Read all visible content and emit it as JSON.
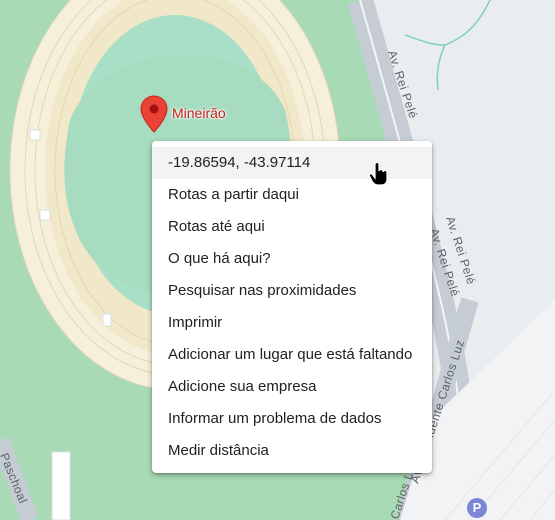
{
  "map": {
    "colors": {
      "field": "#aadfc7",
      "green": "#a8dab5",
      "road": "#c6ccd4",
      "land": "#e9edf0",
      "stands": "#f6efd9",
      "marker": "#ea4335"
    },
    "place": {
      "name": "Mineirão",
      "icon": "map-pin-icon"
    },
    "streets": [
      {
        "id": "rei-pele-top",
        "name": "Av. Rei Pelé"
      },
      {
        "id": "rei-pele-mid",
        "name": "Av. Rei Pelé"
      },
      {
        "id": "rei-pele-low",
        "name": "Av. Rei Pelé"
      },
      {
        "id": "carlos-luz",
        "name": "Av. Presidente Carlos Luz"
      },
      {
        "id": "carlos-luz-2",
        "name": "Carlos Luz"
      },
      {
        "id": "paschoal",
        "name": "Paschoal"
      }
    ],
    "poi": {
      "parking_label": "P",
      "icon": "parking-icon"
    }
  },
  "context_menu": {
    "items": [
      "-19.86594, -43.97114",
      "Rotas a partir daqui",
      "Rotas até aqui",
      "O que há aqui?",
      "Pesquisar nas proximidades",
      "Imprimir",
      "Adicionar um lugar que está faltando",
      "Adicione sua empresa",
      "Informar um problema de dados",
      "Medir distância"
    ]
  },
  "cursor": {
    "icon": "hand-pointer-icon"
  }
}
